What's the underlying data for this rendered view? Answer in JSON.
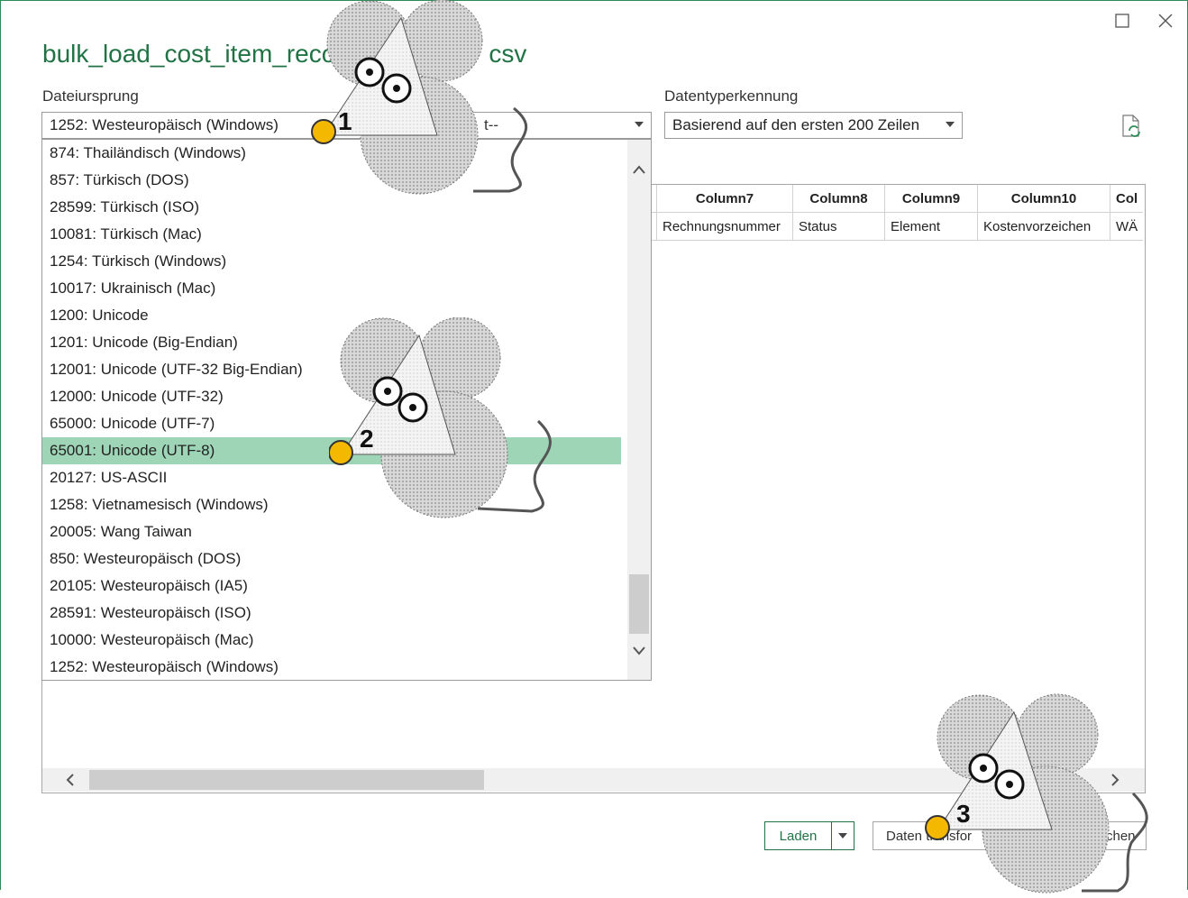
{
  "window": {
    "title": "bulk_load_cost_item_reco",
    "title_suffix": "csv",
    "maximize_icon": "maximize-icon",
    "close_icon": "close-icon"
  },
  "file_origin": {
    "label": "Dateiursprung",
    "value": "1252: Westeuropäisch (Windows)"
  },
  "delimiter": {
    "value": "t--"
  },
  "type_detection": {
    "label": "Datentyperkennung",
    "value": "Basierend auf den ersten 200 Zeilen"
  },
  "refresh_icon": "refresh-icon",
  "dropdown": {
    "options": [
      "874: Thailändisch (Windows)",
      "857: Türkisch (DOS)",
      "28599: Türkisch (ISO)",
      "10081: Türkisch (Mac)",
      "1254: Türkisch (Windows)",
      "10017: Ukrainisch (Mac)",
      "1200: Unicode",
      "1201: Unicode (Big-Endian)",
      "12001: Unicode (UTF-32 Big-Endian)",
      "12000: Unicode (UTF-32)",
      "65000: Unicode (UTF-7)",
      "65001: Unicode (UTF-8)",
      "20127: US-ASCII",
      "1258: Vietnamesisch (Windows)",
      "20005: Wang Taiwan",
      "850: Westeuropäisch (DOS)",
      "20105: Westeuropäisch (IA5)",
      "28591: Westeuropäisch (ISO)",
      "10000: Westeuropäisch (Mac)",
      "1252: Westeuropäisch (Windows)"
    ],
    "selected_index": 11,
    "scroll_position": 0.88
  },
  "preview": {
    "headers": [
      "Column7",
      "Column8",
      "Column9",
      "Column10",
      "Col"
    ],
    "rows": [
      [
        "Rechnungsnummer",
        "Status",
        "Element",
        "Kostenvorzeichen",
        "WÄ"
      ]
    ]
  },
  "buttons": {
    "load": "Laden",
    "transform": "Daten transfor",
    "transform_tail": "chen"
  },
  "markers": [
    "1",
    "2",
    "3"
  ],
  "colors": {
    "accent": "#217346",
    "selection": "#9fd5b7",
    "marker": "#f5b800"
  }
}
